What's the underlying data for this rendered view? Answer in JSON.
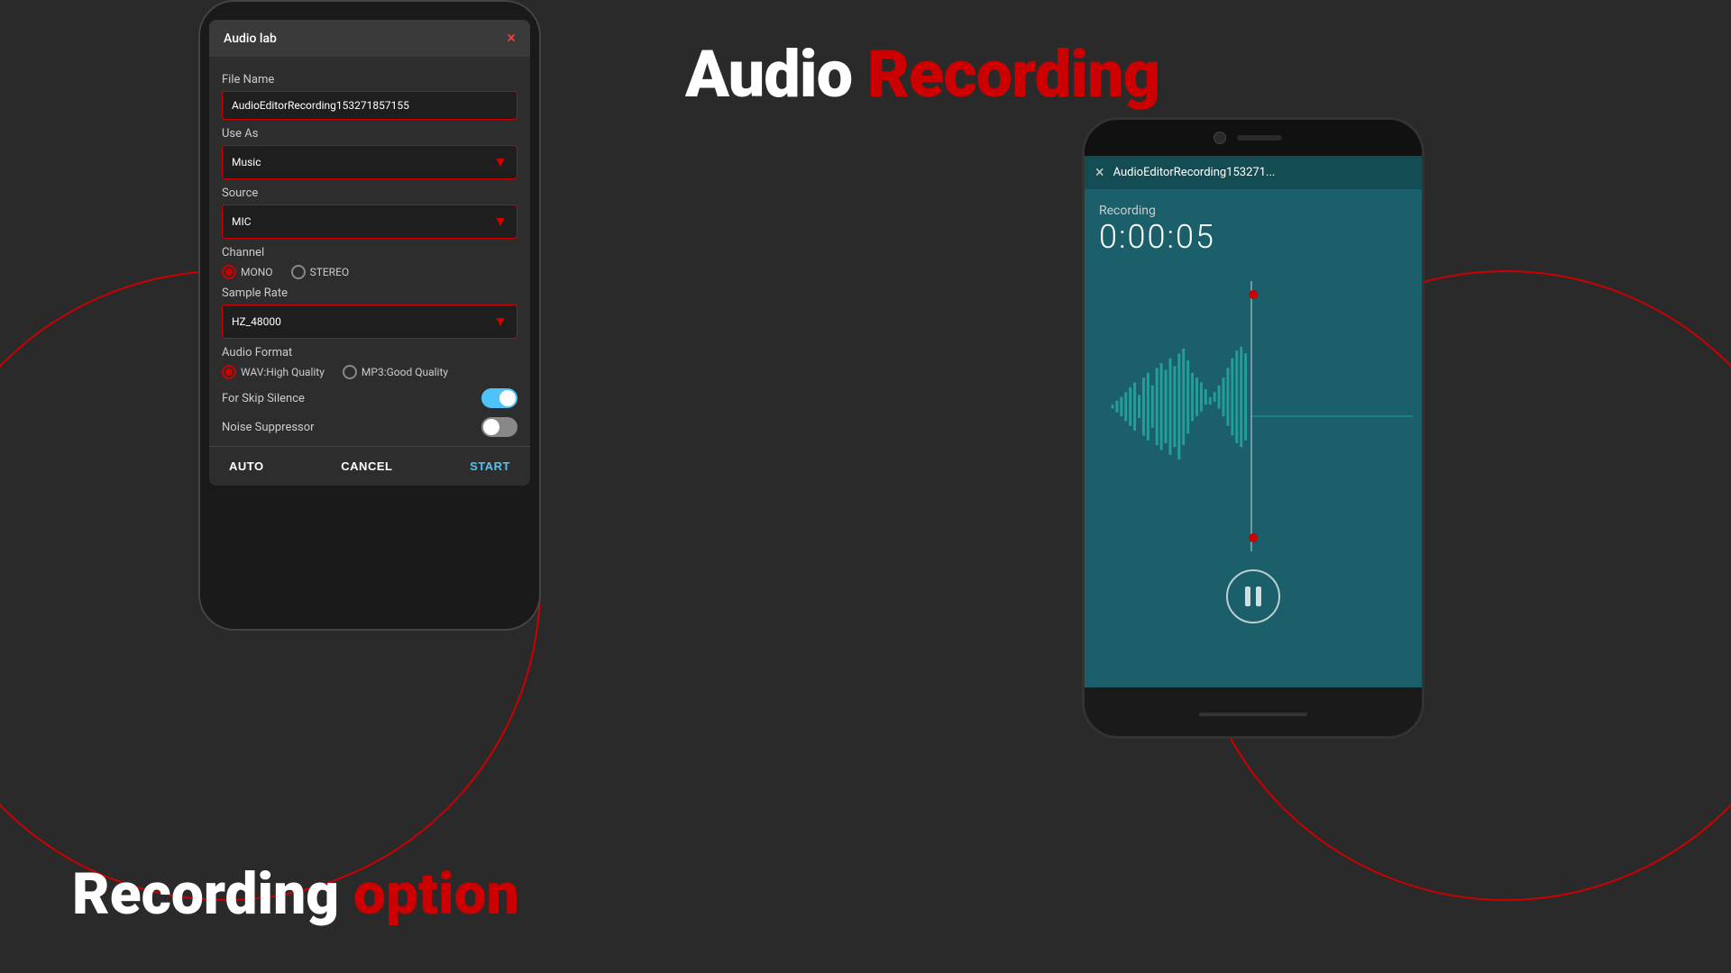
{
  "background": {
    "color": "#2a2a2a"
  },
  "main_title": {
    "white_part": "Audio ",
    "red_part": "Recording"
  },
  "bottom_title": {
    "white_part": "Recording ",
    "red_part": "option"
  },
  "mic_label": "Mic",
  "skip_silence_label": "For Skip Silence",
  "left_dialog": {
    "header": {
      "title": "Audio lab",
      "close_icon": "×"
    },
    "file_name": {
      "label": "File Name",
      "value": "AudioEditorRecording153271857155"
    },
    "use_as": {
      "label": "Use As",
      "value": "Music"
    },
    "source": {
      "label": "Source",
      "value": "MIC"
    },
    "channel": {
      "label": "Channel",
      "mono_label": "MONO",
      "stereo_label": "STEREO"
    },
    "sample_rate": {
      "label": "Sample Rate",
      "value": "HZ_48000"
    },
    "audio_format": {
      "label": "Audio Format",
      "wav_label": "WAV:High Quality",
      "mp3_label": "MP3:Good Quality"
    },
    "for_skip_silence": {
      "label": "For Skip Silence"
    },
    "noise_suppressor": {
      "label": "Noise Suppressor"
    },
    "buttons": {
      "auto": "AUTO",
      "cancel": "CANCEL",
      "start": "START"
    }
  },
  "right_screen": {
    "filename": "AudioEditorRecording153271...",
    "close_icon": "×",
    "recording_label": "Recording",
    "time": "0:00:05"
  }
}
